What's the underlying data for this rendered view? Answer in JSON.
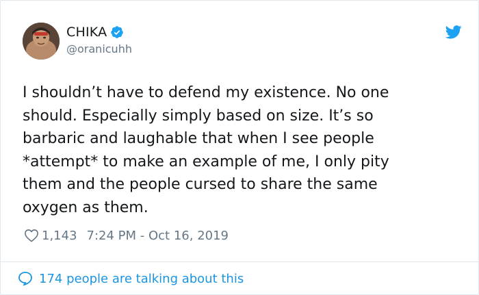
{
  "author": {
    "display_name": "CHIKA",
    "handle": "@oranicuhh",
    "avatar_icon": "profile-photo",
    "verified_icon": "verified-badge-icon"
  },
  "tweet": {
    "text": "I shouldn’t have to defend my existence. No one\nshould. Especially simply based on size. It’s so\nbarbaric and laughable that when I see people\n*attempt* to make an example of me, I only pity\nthem and the people cursed to share the same\noxygen as them.",
    "likes": "1,143",
    "timestamp": "7:24 PM - Oct 16, 2019"
  },
  "footer": {
    "talking_label": "174 people are talking about this"
  },
  "colors": {
    "brand": "#1da1f2",
    "link": "#1b95e0",
    "muted": "#657786",
    "text": "#14171a",
    "border": "#e1e8ed"
  },
  "icons": {
    "brand": "twitter-bird-icon",
    "like": "heart-icon",
    "conversation": "speech-bubble-icon"
  }
}
